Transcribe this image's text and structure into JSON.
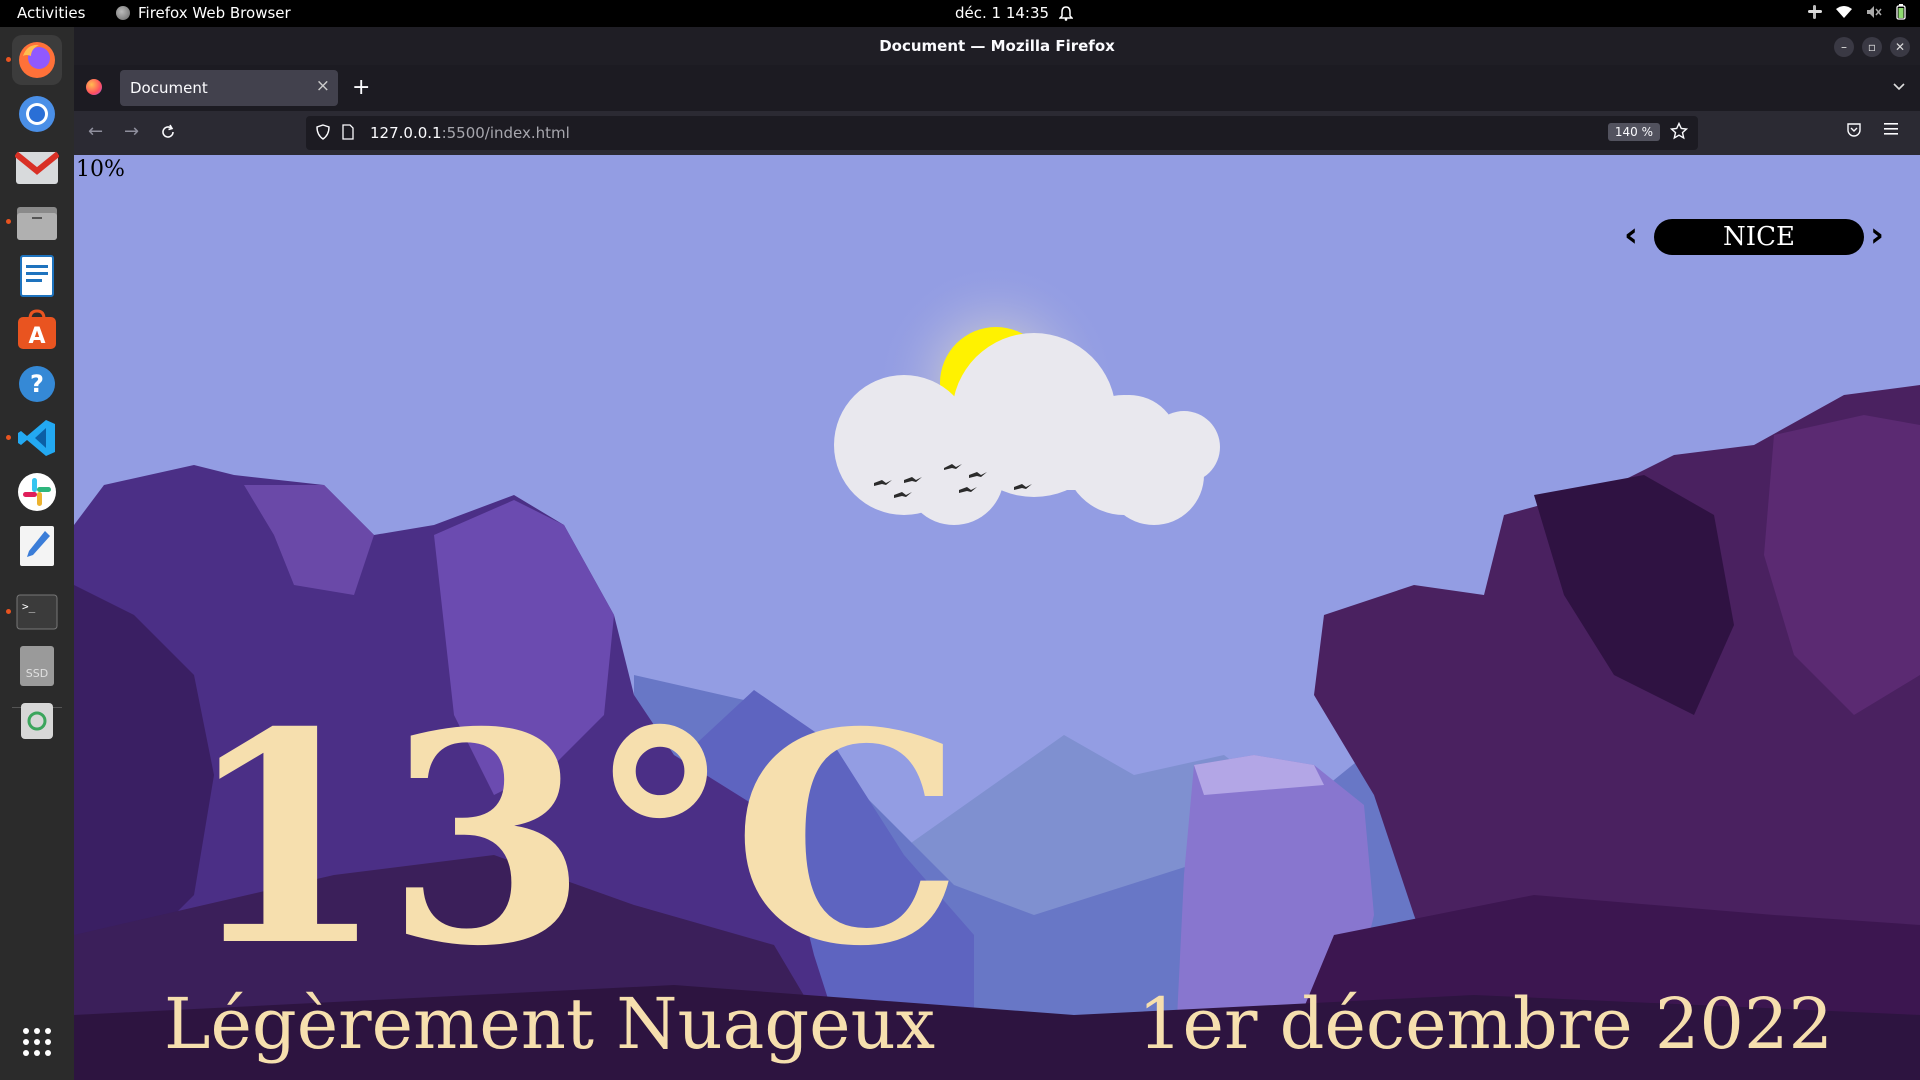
{
  "topbar": {
    "activities": "Activities",
    "app_name": "Firefox Web Browser",
    "clock": "déc. 1  14:35"
  },
  "window": {
    "title": "Document — Mozilla Firefox"
  },
  "tabs": [
    {
      "label": "Document"
    }
  ],
  "urlbar": {
    "url_host": "127.0.0.1",
    "url_rest": ":5500/index.html",
    "zoom": "140 %"
  },
  "page": {
    "percent": "10%",
    "city": "NICE",
    "temperature": "13°C",
    "condition": "Légèrement Nuageux",
    "date": "1er décembre 2022"
  },
  "dock": {
    "items": [
      "firefox-icon",
      "chromium-icon",
      "gmail-icon",
      "files-icon",
      "writer-icon",
      "software-icon",
      "help-icon",
      "vscode-icon",
      "slack-icon",
      "text-editor-icon",
      "terminal-icon",
      "ssd-icon",
      "trash-icon",
      "app-grid-icon"
    ]
  },
  "colors": {
    "sky": "#939de3",
    "text_cream": "#f6dfae",
    "sun": "#fff200"
  }
}
